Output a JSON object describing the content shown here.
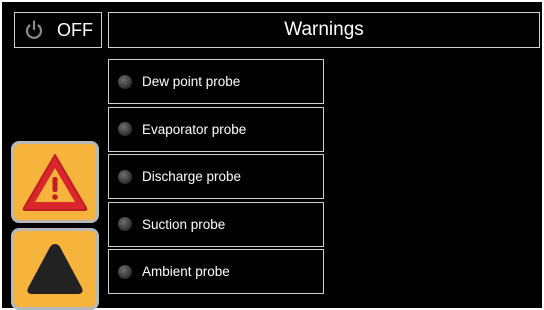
{
  "power": {
    "label": "OFF",
    "icon": "power-icon"
  },
  "header": {
    "title": "Warnings"
  },
  "warnings": [
    {
      "label": "Dew point probe",
      "status": "inactive"
    },
    {
      "label": "Evaporator probe",
      "status": "inactive"
    },
    {
      "label": "Discharge probe",
      "status": "inactive"
    },
    {
      "label": "Suction probe",
      "status": "inactive"
    },
    {
      "label": "Ambient probe",
      "status": "inactive"
    }
  ],
  "side_buttons": [
    {
      "icon": "warning-triangle-icon"
    },
    {
      "icon": "up-arrow-icon"
    }
  ],
  "colors": {
    "background": "#000000",
    "button": "#f7b43d",
    "alarm_red": "#d8262b",
    "led_off": "#4a4a4a"
  }
}
